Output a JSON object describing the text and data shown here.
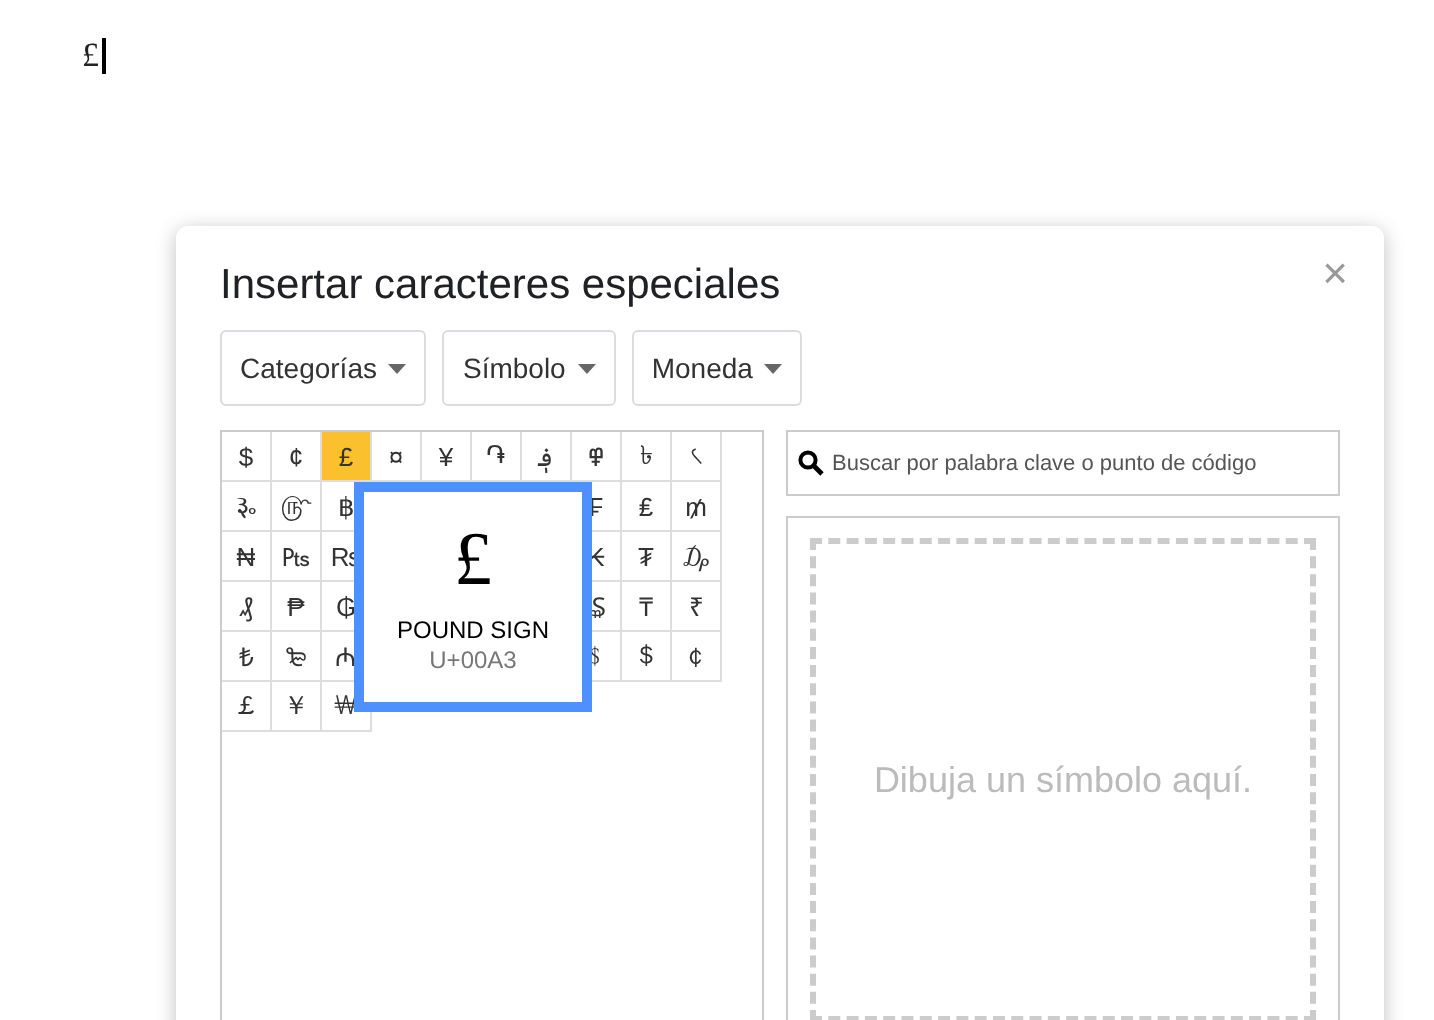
{
  "document": {
    "text": "£"
  },
  "dialog": {
    "title": "Insertar caracteres especiales",
    "close": "×",
    "dropdowns": [
      {
        "label": "Categorías"
      },
      {
        "label": "Símbolo"
      },
      {
        "label": "Moneda"
      }
    ],
    "grid": {
      "rows": [
        [
          {
            "kind": "char",
            "char": "$",
            "selected": false
          },
          {
            "kind": "char",
            "char": "¢",
            "selected": false
          },
          {
            "kind": "char",
            "char": "£",
            "selected": true
          },
          {
            "kind": "char",
            "char": "¤",
            "selected": false
          },
          {
            "kind": "char",
            "char": "¥",
            "selected": false
          },
          {
            "kind": "char",
            "char": "֏",
            "selected": false
          },
          {
            "kind": "char",
            "char": "؋",
            "selected": false
          },
          {
            "kind": "char",
            "char": "߾",
            "selected": false
          },
          {
            "kind": "char",
            "char": "৳",
            "selected": false
          },
          {
            "kind": "char",
            "char": "৻",
            "selected": false
          }
        ],
        [
          {
            "kind": "char",
            "char": "૱",
            "selected": false
          },
          {
            "kind": "char",
            "char": "௹",
            "selected": false
          },
          {
            "kind": "char",
            "char": "฿",
            "selected": false
          },
          {
            "kind": "blank"
          },
          {
            "kind": "blank"
          },
          {
            "kind": "blank"
          },
          {
            "kind": "blank"
          },
          {
            "kind": "char",
            "char": "₣",
            "selected": false
          },
          {
            "kind": "char",
            "char": "₤",
            "selected": false
          },
          {
            "kind": "char",
            "char": "₥",
            "selected": false
          }
        ],
        [
          {
            "kind": "char",
            "char": "₦",
            "selected": false
          },
          {
            "kind": "char",
            "char": "₧",
            "selected": false
          },
          {
            "kind": "char",
            "char": "₨",
            "selected": false
          },
          {
            "kind": "blank"
          },
          {
            "kind": "blank"
          },
          {
            "kind": "blank"
          },
          {
            "kind": "blank"
          },
          {
            "kind": "char",
            "char": "₭",
            "selected": false
          },
          {
            "kind": "char",
            "char": "₮",
            "selected": false
          },
          {
            "kind": "char",
            "char": "₯",
            "selected": false
          }
        ],
        [
          {
            "kind": "char",
            "char": "₰",
            "selected": false
          },
          {
            "kind": "char",
            "char": "₱",
            "selected": false
          },
          {
            "kind": "char",
            "char": "₲",
            "selected": false
          },
          {
            "kind": "blank"
          },
          {
            "kind": "blank"
          },
          {
            "kind": "blank"
          },
          {
            "kind": "blank"
          },
          {
            "kind": "char",
            "char": "₷",
            "selected": false
          },
          {
            "kind": "char",
            "char": "₸",
            "selected": false
          },
          {
            "kind": "char",
            "char": "₹",
            "selected": false
          }
        ],
        [
          {
            "kind": "char",
            "char": "₺",
            "selected": false
          },
          {
            "kind": "char",
            "char": "₻",
            "selected": false
          },
          {
            "kind": "char",
            "char": "₼",
            "selected": false
          },
          {
            "kind": "blank"
          },
          {
            "kind": "blank"
          },
          {
            "kind": "blank"
          },
          {
            "kind": "blank"
          },
          {
            "kind": "char",
            "char": "﹩",
            "selected": false
          },
          {
            "kind": "char",
            "char": "＄",
            "selected": false
          },
          {
            "kind": "char",
            "char": "￠",
            "selected": false
          }
        ],
        [
          {
            "kind": "char",
            "char": "￡",
            "selected": false
          },
          {
            "kind": "char",
            "char": "￥",
            "selected": false
          },
          {
            "kind": "char",
            "char": "￦",
            "selected": false
          }
        ]
      ]
    },
    "preview": {
      "char": "£",
      "name": "POUND SIGN",
      "code": "U+00A3"
    },
    "search": {
      "placeholder": "Buscar por palabra clave o punto de código"
    },
    "draw_area": {
      "hint": "Dibuja un símbolo aquí."
    }
  }
}
